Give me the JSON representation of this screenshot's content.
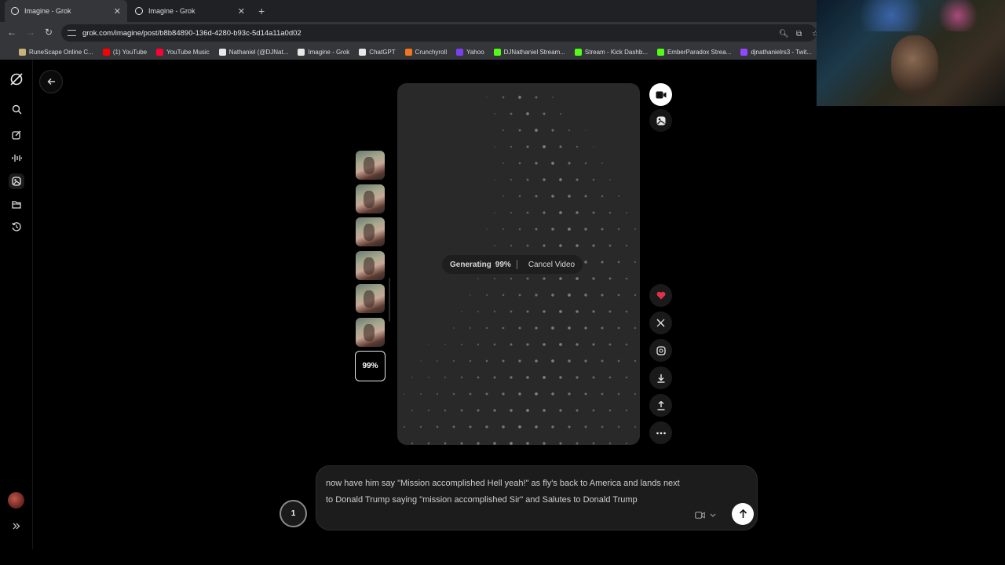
{
  "browser": {
    "tabs": [
      {
        "title": "Imagine - Grok",
        "active": true
      },
      {
        "title": "Imagine - Grok",
        "active": false
      }
    ],
    "new_tab_icon": "plus-icon",
    "url": "grok.com/imagine/post/b8b84890-136d-4280-b93c-5d14a11a0d02",
    "bookmarks": [
      {
        "label": "RuneScape Online C...",
        "icon": "runescape-icon",
        "color": "#c8b27a"
      },
      {
        "label": "(1) YouTube",
        "icon": "youtube-icon",
        "color": "#ff0000"
      },
      {
        "label": "YouTube Music",
        "icon": "youtube-music-icon",
        "color": "#ff0033"
      },
      {
        "label": "Nathaniel (@DJNat...",
        "icon": "x-icon",
        "color": "#e8e8e8"
      },
      {
        "label": "Imagine - Grok",
        "icon": "grok-icon",
        "color": "#e8e8e8"
      },
      {
        "label": "ChatGPT",
        "icon": "chatgpt-icon",
        "color": "#e8e8e8"
      },
      {
        "label": "Crunchyroll",
        "icon": "crunchyroll-icon",
        "color": "#f47521"
      },
      {
        "label": "Yahoo",
        "icon": "yahoo-icon",
        "color": "#7b3ff2"
      },
      {
        "label": "DJNathaniel Stream...",
        "icon": "kick-icon",
        "color": "#53fc18"
      },
      {
        "label": "Stream - Kick Dashb...",
        "icon": "kick-icon",
        "color": "#53fc18"
      },
      {
        "label": "EmberParadox Strea...",
        "icon": "kick-icon",
        "color": "#53fc18"
      },
      {
        "label": "djnathanielrs3 - Twit...",
        "icon": "twitch-icon",
        "color": "#9146ff"
      }
    ]
  },
  "sidebar": {
    "items": [
      {
        "name": "search",
        "icon": "search-icon"
      },
      {
        "name": "create",
        "icon": "edit-icon"
      },
      {
        "name": "voice",
        "icon": "waveform-icon"
      },
      {
        "name": "imagine",
        "icon": "imagine-icon",
        "active": true
      },
      {
        "name": "projects",
        "icon": "folder-icon"
      },
      {
        "name": "history",
        "icon": "history-icon"
      }
    ],
    "expand_icon": "double-chevron-right-icon"
  },
  "generation": {
    "status_label": "Generating",
    "progress_percent": "99%",
    "progress_fraction": 0.99,
    "cancel_label": "Cancel Video",
    "thumb_count": 6,
    "current_thumb_label": "99%"
  },
  "actions": {
    "mode_video_icon": "video-camera-icon",
    "mode_image_icon": "image-icon",
    "like_icon": "heart-icon",
    "share_x_icon": "x-icon",
    "remix_icon": "remix-icon",
    "download_icon": "download-icon",
    "upload_icon": "share-upload-icon",
    "more_icon": "more-horizontal-icon",
    "like_color": "#e0314b"
  },
  "prompt": {
    "queue_count": "1",
    "text": "now have him say \"Mission accomplished Hell yeah!\" as fly's back to America and lands next to Donald Trump saying \"mission accomplished Sir\" and Salutes to Donald Trump",
    "mode_icon": "video-camera-icon",
    "send_icon": "arrow-up-icon"
  }
}
